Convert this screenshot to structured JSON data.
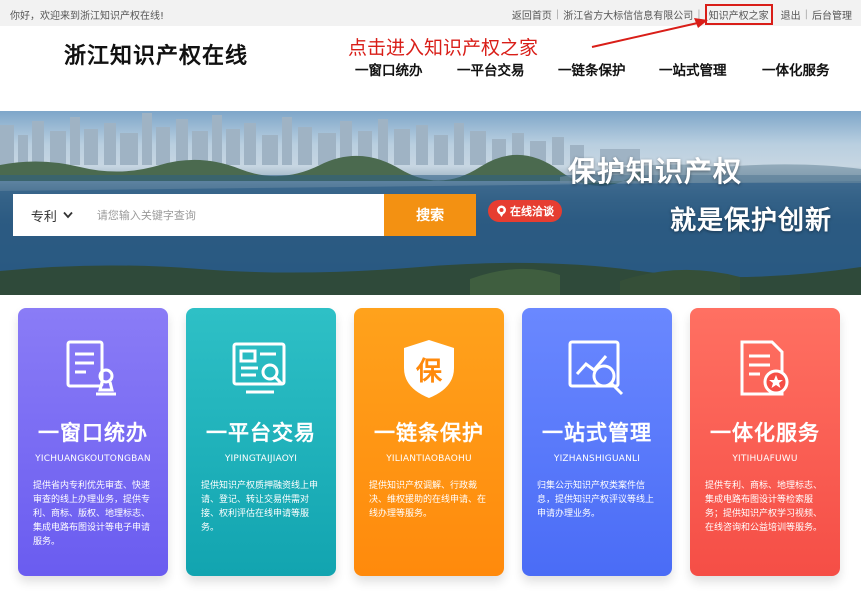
{
  "topbar": {
    "welcome": "你好，欢迎来到浙江知识产权在线!",
    "links": [
      "返回首页",
      "浙江省方大标信信息有限公司",
      "知识产权之家",
      "退出",
      "后台管理"
    ]
  },
  "header": {
    "logo": "浙江知识产权在线",
    "annotation": "点击进入知识产权之家",
    "nav": [
      "一窗口统办",
      "一平台交易",
      "一链条保护",
      "一站式管理",
      "一体化服务"
    ]
  },
  "banner": {
    "slogan_line1": "保护知识产权",
    "slogan_line2": "就是保护创新",
    "search": {
      "type_selected": "专利",
      "placeholder": "请您输入关键字查询",
      "button": "搜索"
    },
    "chat_button": "在线洽谈"
  },
  "cards": [
    {
      "title": "一窗口统办",
      "pinyin": "YICHUANGKOUTONGBAN",
      "desc": "提供省内专利优先审查、快速审查的线上办理业务，提供专利、商标、版权、地理标志、集成电路布图设计等电子申请服务。",
      "icon": "document-stamp-icon",
      "color_top": "#8a7cf6",
      "color_bottom": "#6a5cf0"
    },
    {
      "title": "一平台交易",
      "pinyin": "YIPINGTAIJIAOYI",
      "desc": "提供知识产权质押融资线上申请、登记、转让交易供需对接、权利评估在线申请等服务。",
      "icon": "trade-document-icon",
      "color_top": "#2ec0c6",
      "color_bottom": "#12a4b0"
    },
    {
      "title": "一链条保护",
      "pinyin": "YILIANTIAOBAOHU",
      "desc": "提供知识产权调解、行政裁决、维权援助的在线申请、在线办理等服务。",
      "icon": "shield-protect-icon",
      "color_top": "#ffa21c",
      "color_bottom": "#ff8a0c"
    },
    {
      "title": "一站式管理",
      "pinyin": "YIZHANSHIGUANLI",
      "desc": "归集公示知识产权类案件信息，提供知识产权评议等线上申请办理业务。",
      "icon": "search-chart-icon",
      "color_top": "#6a88ff",
      "color_bottom": "#4a6cf6"
    },
    {
      "title": "一体化服务",
      "pinyin": "YITIHUAFUWU",
      "desc": "提供专利、商标、地理标志、集成电路布图设计等检索服务；提供知识产权学习视频、在线咨询和公益培训等服务。",
      "icon": "document-star-icon",
      "color_top": "#ff7062",
      "color_bottom": "#f54e46"
    }
  ]
}
